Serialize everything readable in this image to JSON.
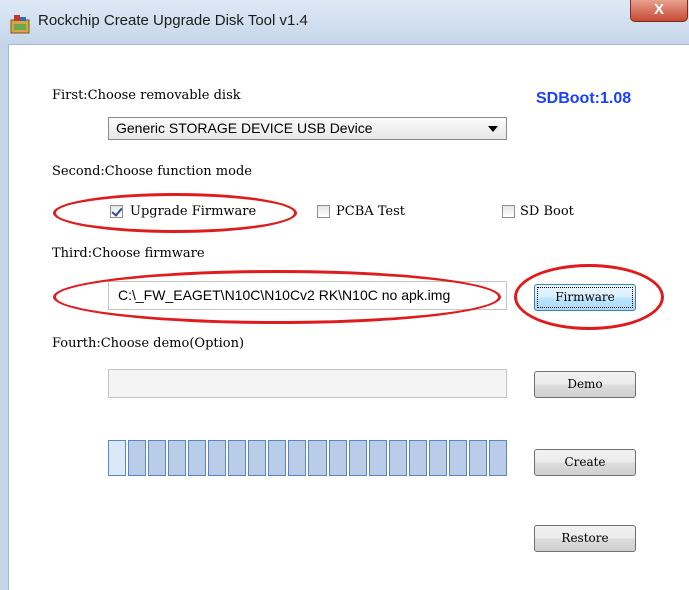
{
  "window": {
    "title": "Rockchip Create Upgrade Disk Tool v1.4",
    "close_label": "X"
  },
  "version_label": "SDBoot:1.08",
  "step1": {
    "label": "First:Choose removable disk",
    "selected_disk": "Generic STORAGE DEVICE USB Device"
  },
  "step2": {
    "label": "Second:Choose function mode",
    "options": [
      {
        "label": "Upgrade Firmware",
        "checked": true
      },
      {
        "label": "PCBA Test",
        "checked": false
      },
      {
        "label": "SD Boot",
        "checked": false
      }
    ]
  },
  "step3": {
    "label": "Third:Choose firmware",
    "firmware_path": "C:\\_FW_EAGET\\N10C\\N10Cv2 RK\\N10C no apk.img",
    "button_label": "Firmware"
  },
  "step4": {
    "label": "Fourth:Choose demo(Option)",
    "demo_path": "",
    "button_label": "Demo"
  },
  "progress": {
    "segments": 20,
    "filled_segments": 1
  },
  "actions": {
    "create_label": "Create",
    "restore_label": "Restore"
  },
  "colors": {
    "annotation": "#e01b1b",
    "version_text": "#1a3fff"
  }
}
